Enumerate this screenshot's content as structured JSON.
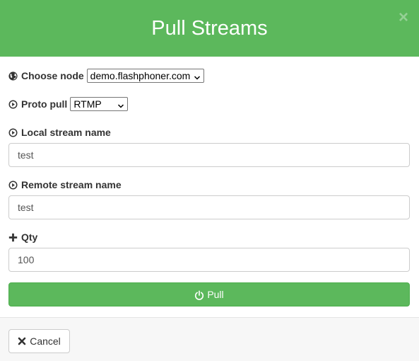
{
  "dialog": {
    "title": "Pull Streams",
    "close_label": "×"
  },
  "form": {
    "choose_node": {
      "label": "Choose node",
      "selected": "demo.flashphoner.com",
      "icon": "globe-icon"
    },
    "proto_pull": {
      "label": "Proto pull",
      "selected": "RTMP",
      "icon": "play-circle-icon"
    },
    "local_stream_name": {
      "label": "Local stream name",
      "value": "test",
      "icon": "play-circle-icon"
    },
    "remote_stream_name": {
      "label": "Remote stream name",
      "value": "test",
      "icon": "play-circle-icon"
    },
    "qty": {
      "label": "Qty",
      "value": "100",
      "icon": "plus-icon"
    }
  },
  "actions": {
    "pull_label": "Pull",
    "pull_icon": "power-icon",
    "cancel_label": "Cancel",
    "cancel_icon": "close-icon"
  },
  "colors": {
    "header": "#5cb85c",
    "pull_button": "#5cb85c",
    "footer": "#f7f7f7"
  }
}
